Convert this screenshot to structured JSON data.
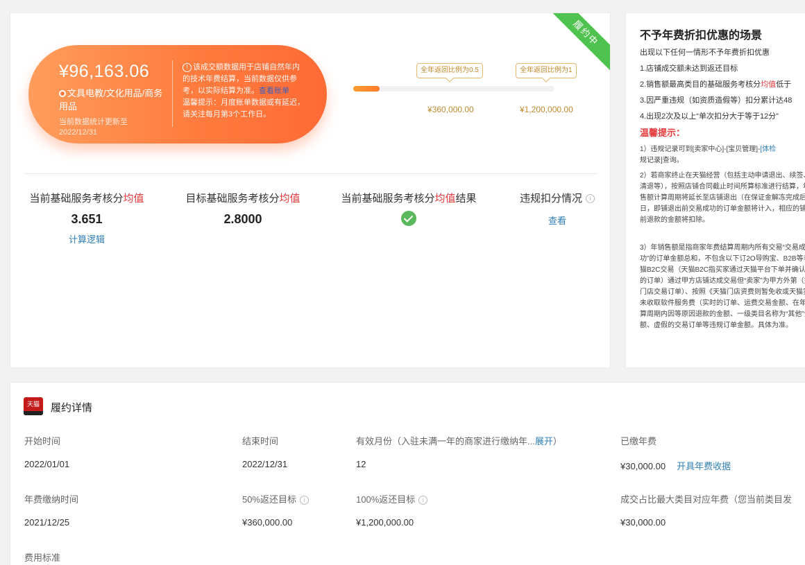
{
  "status_ribbon": "履约中",
  "card": {
    "amount": "¥96,163.06",
    "category": "文具电教/文化用品/商务用品",
    "updated": "当前数据统计更新至2022/12/31",
    "note_text": "该成交额数据用于店铺自然年内的技术年费结算，当前数据仅供参考，以实际结算为准。",
    "note_link": "查看账单",
    "warm_tip": "温馨提示：月度账单数据或有延迟，请关注每月第3个工作日。"
  },
  "progress": {
    "fill_fraction": 0.13,
    "markers": [
      {
        "label": "全年返回比例为0.5",
        "value": "¥360,000.00"
      },
      {
        "label": "全年返回比例为1",
        "value": "¥1,200,000.00"
      }
    ]
  },
  "metrics": [
    {
      "label_pre": "当前基础服务考核分",
      "label_red": "均值",
      "label_post": "",
      "value": "3.651",
      "link": "计算逻辑"
    },
    {
      "label_pre": "目标基础服务考核分",
      "label_red": "均值",
      "label_post": "",
      "value": "2.8000"
    },
    {
      "label_pre": "当前基础服务考核分",
      "label_red": "均值",
      "label_post": "结果"
    },
    {
      "label_pre": "违规扣分情况",
      "link": "查看"
    }
  ],
  "right_panel": {
    "title": "不予年费折扣优惠的场景",
    "intro": "出现以下任何一情形不予年费折扣优惠",
    "items": [
      "1.店铺成交额未达到返还目标",
      "2.销售额最高类目的基础服务考核分",
      "均值",
      "低于",
      "3.因严重违规（如资质造假等）扣分累计达48",
      "4.出现2次及以上“单次扣分大于等于12分”"
    ],
    "tip_title": "温馨提示：",
    "p1_a": "1）违规记录可到[卖家中心]-[宝贝管理]-",
    "p1_link": "[体检",
    "p1_b": "规记录]查询。",
    "p2": "2）若商家终止在天猫经营（包括主动申请退出、续签、被清退等），按照店铺合同截止时间所算标准进行结算，年销售额计算周期将延长至店铺退出（在保证金解冻完成后）”之日，即铺退出前交易成功的订单金额将计入，相应的铺退出前退款的金额将扣除。",
    "p3": "3）年销售额是指商家年费结算周期内所有交易“交易成功”的订单金额总和，不包含以下订2O导购宝、B2B等非天猫B2C交易（天猫B2C指买家通过天猫平台下单并确认收货的订单）通过甲方店铺达成交易但“卖家”为甲方外第（如：门店交易订单）、按照《天猫门店资费则暂免收或天猫实际未收取软件服务费（实时的订单、运费交易金额、在年费结算周期内因等原因退款的金额、一级类目名称为“其他”金额、虚假的交易订单等违规订单金额。具体为准。"
  },
  "bottom": {
    "logo_text": "天猫",
    "title": "履约详情",
    "row1": {
      "start_label": "开始时间",
      "start_value": "2022/01/01",
      "end_label": "结束时间",
      "end_value": "2022/12/31",
      "months_label": "有效月份（入驻未满一年的商家进行缴纳年...",
      "months_expand": "展开",
      "months_close": "）",
      "months_value": "12",
      "paid_label": "已缴年费",
      "paid_value": "¥30,000.00",
      "paid_link": "开具年费收据"
    },
    "row2": {
      "pay_time_label": "年费缴纳时间",
      "pay_time_value": "2021/12/25",
      "t50_label": "50%返还目标",
      "t50_value": "¥360,000.00",
      "t100_label": "100%返还目标",
      "t100_value": "¥1,200,000.00",
      "max_label": "成交占比最大类目对应年费（您当前类目发",
      "max_value": "¥30,000.00"
    },
    "fee_label": "费用标准"
  }
}
